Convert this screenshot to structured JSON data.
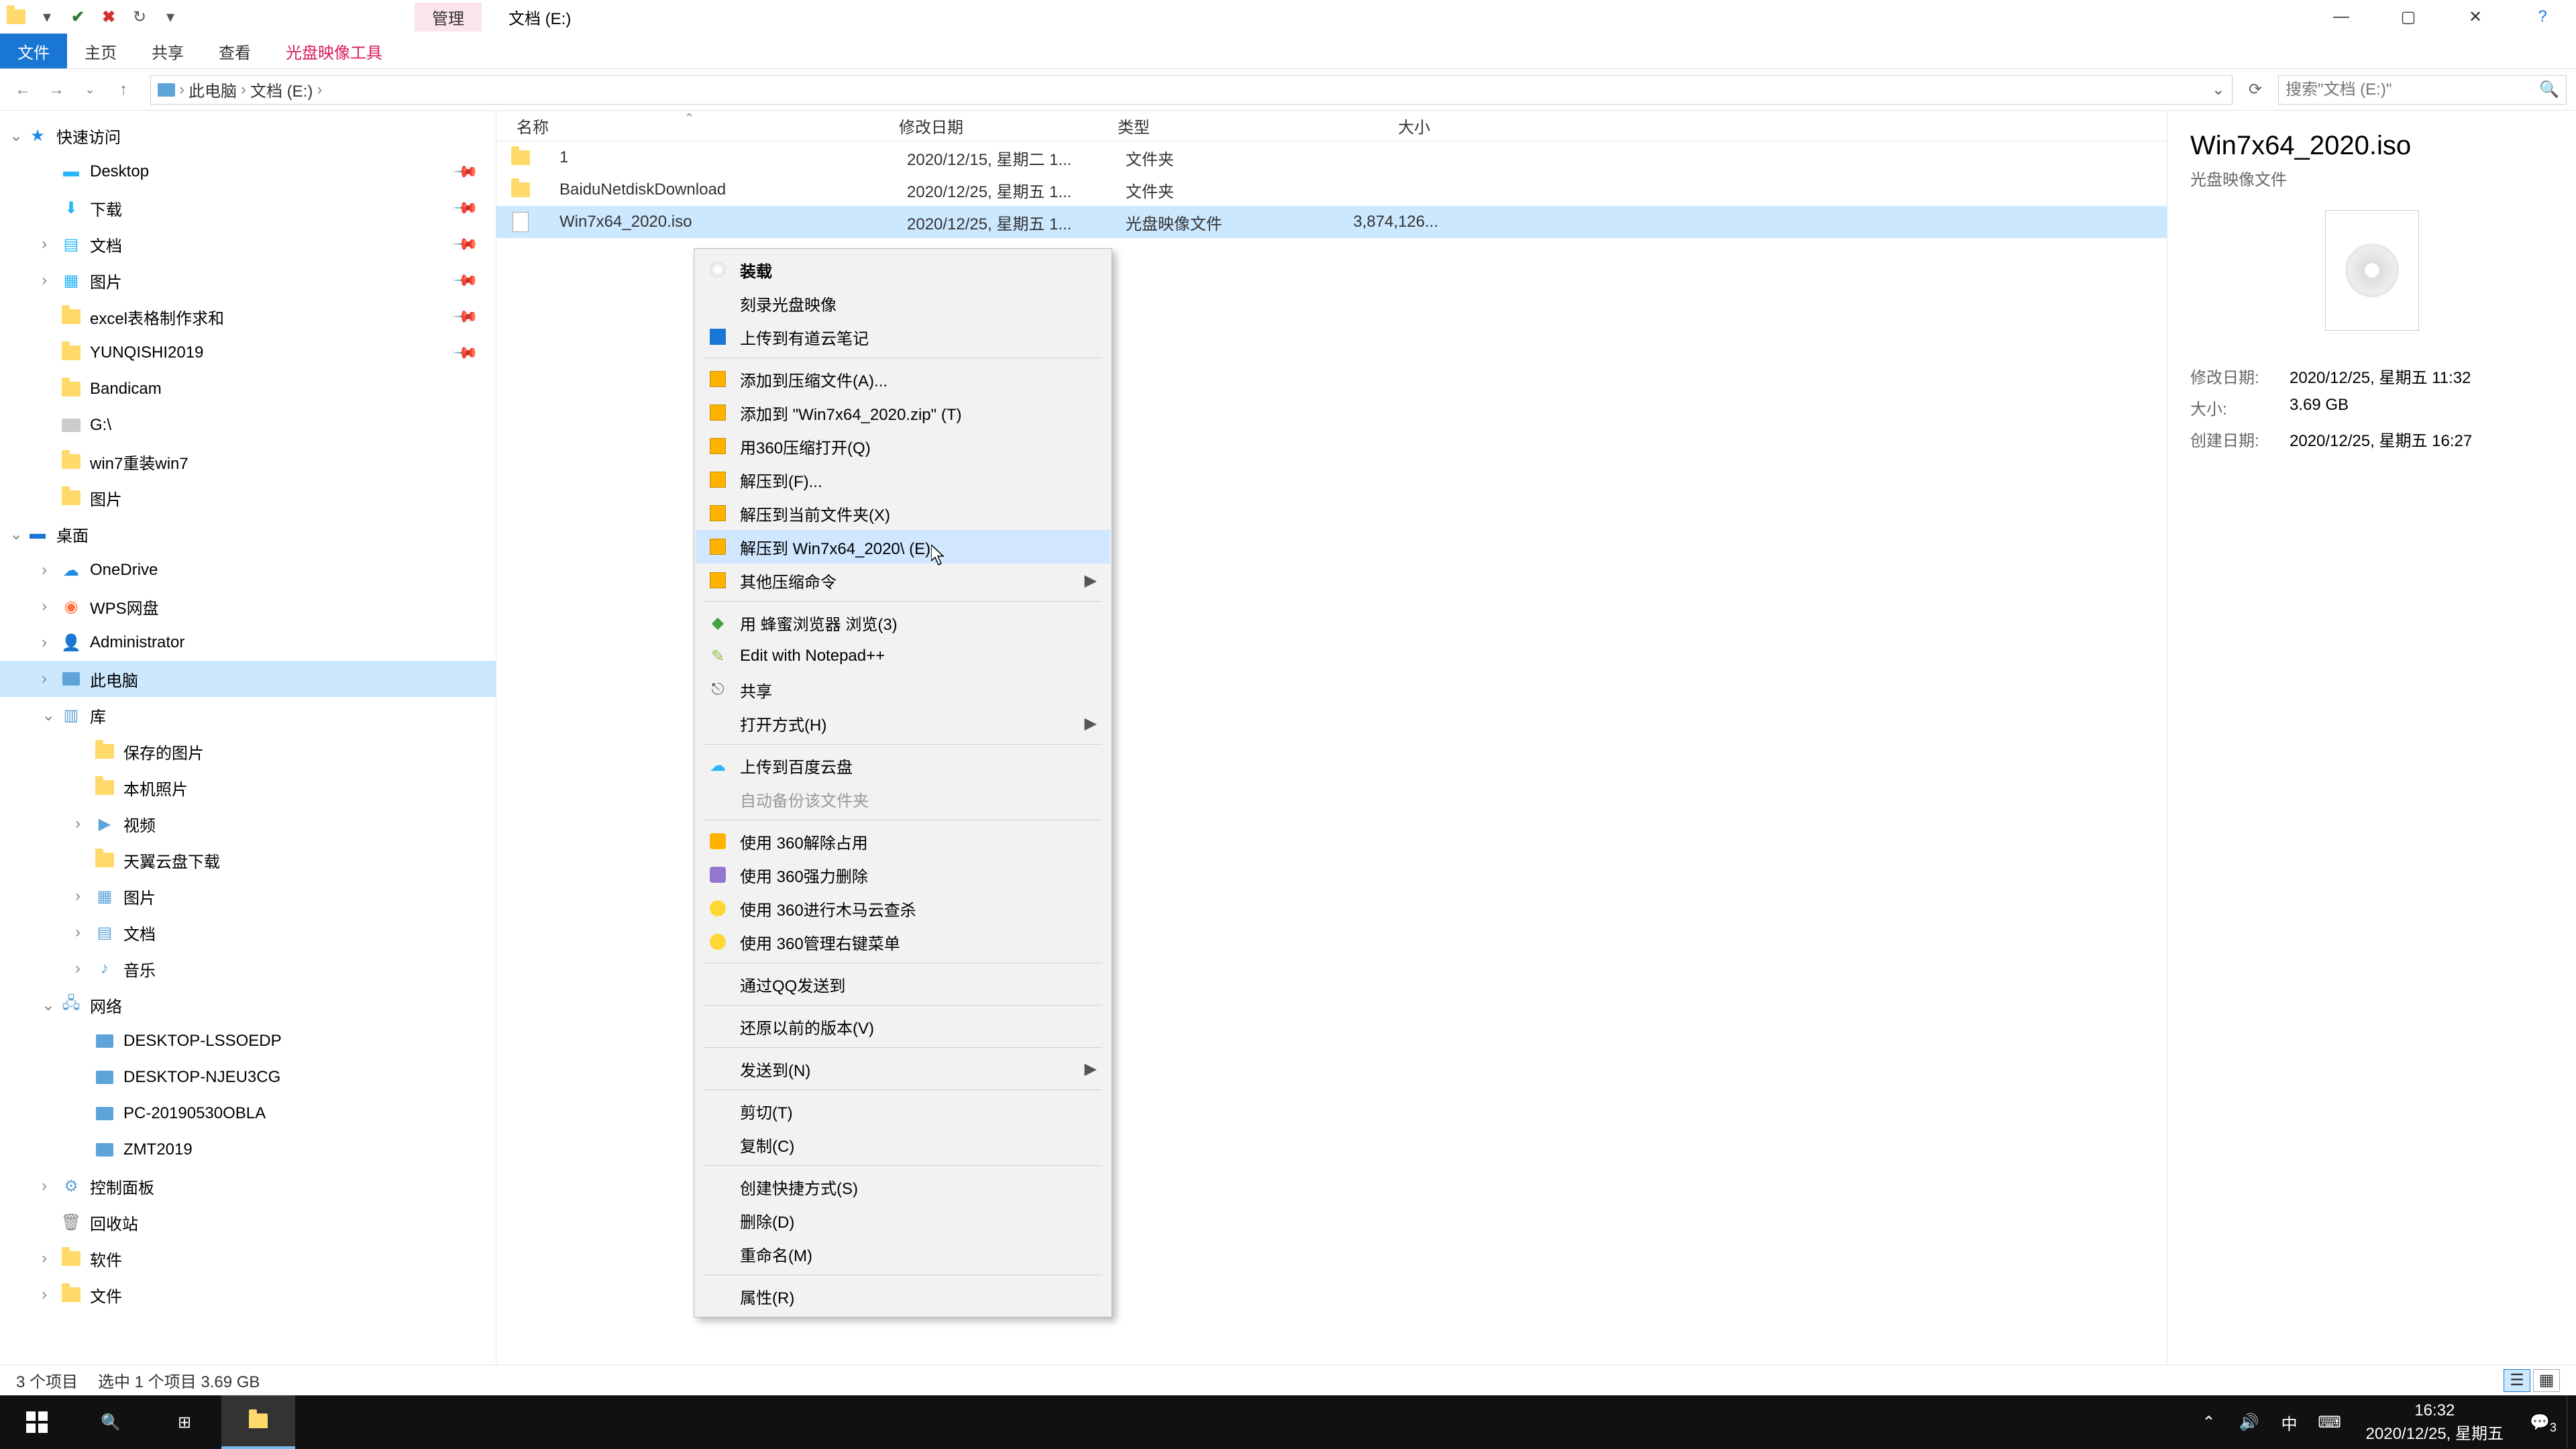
{
  "titlebar": {
    "contextual_tab": "管理",
    "title": "文档 (E:)"
  },
  "ribbon": {
    "file": "文件",
    "home": "主页",
    "share": "共享",
    "view": "查看",
    "disc_tools": "光盘映像工具"
  },
  "address": {
    "root": "此电脑",
    "folder": "文档 (E:)",
    "search_placeholder": "搜索\"文档 (E:)\""
  },
  "tree": {
    "quick": "快速访问",
    "desktop": "Desktop",
    "downloads": "下载",
    "documents": "文档",
    "pictures": "图片",
    "excel": "excel表格制作求和",
    "yunqishi": "YUNQISHI2019",
    "bandicam": "Bandicam",
    "gdrive": "G:\\",
    "win7reset": "win7重装win7",
    "pictures2": "图片",
    "desktop_root": "桌面",
    "onedrive": "OneDrive",
    "wps": "WPS网盘",
    "admin": "Administrator",
    "thispc": "此电脑",
    "libraries": "库",
    "saved_pics": "保存的图片",
    "camera_roll": "本机照片",
    "videos": "视频",
    "tianyi": "天翼云盘下载",
    "lib_pics": "图片",
    "lib_docs": "文档",
    "lib_music": "音乐",
    "network": "网络",
    "pc1": "DESKTOP-LSSOEDP",
    "pc2": "DESKTOP-NJEU3CG",
    "pc3": "PC-20190530OBLA",
    "pc4": "ZMT2019",
    "ctrlpanel": "控制面板",
    "recycle": "回收站",
    "software": "软件",
    "files": "文件"
  },
  "columns": {
    "name": "名称",
    "date": "修改日期",
    "type": "类型",
    "size": "大小"
  },
  "files": [
    {
      "name": "1",
      "date": "2020/12/15, 星期二 1...",
      "type": "文件夹",
      "size": "",
      "icon": "folder"
    },
    {
      "name": "BaiduNetdiskDownload",
      "date": "2020/12/25, 星期五 1...",
      "type": "文件夹",
      "size": "",
      "icon": "folder"
    },
    {
      "name": "Win7x64_2020.iso",
      "date": "2020/12/25, 星期五 1...",
      "type": "光盘映像文件",
      "size": "3,874,126...",
      "icon": "disc",
      "selected": true
    }
  ],
  "context_menu": [
    {
      "label": "装载",
      "bold": true,
      "icon": "disc"
    },
    {
      "label": "刻录光盘映像"
    },
    {
      "label": "上传到有道云笔记",
      "icon": "blue"
    },
    {
      "sep": true
    },
    {
      "label": "添加到压缩文件(A)...",
      "icon": "zip"
    },
    {
      "label": "添加到 \"Win7x64_2020.zip\" (T)",
      "icon": "zip"
    },
    {
      "label": "用360压缩打开(Q)",
      "icon": "zip"
    },
    {
      "label": "解压到(F)...",
      "icon": "zip"
    },
    {
      "label": "解压到当前文件夹(X)",
      "icon": "zip"
    },
    {
      "label": "解压到 Win7x64_2020\\ (E)",
      "icon": "zip",
      "hover": true
    },
    {
      "label": "其他压缩命令",
      "icon": "zip",
      "arrow": true
    },
    {
      "sep": true
    },
    {
      "label": "用 蜂蜜浏览器 浏览(3)",
      "icon": "green"
    },
    {
      "label": "Edit with Notepad++",
      "icon": "npp"
    },
    {
      "label": "共享",
      "icon": "share"
    },
    {
      "label": "打开方式(H)",
      "arrow": true
    },
    {
      "sep": true
    },
    {
      "label": "上传到百度云盘",
      "icon": "cloud"
    },
    {
      "label": "自动备份该文件夹",
      "disabled": true
    },
    {
      "sep": true
    },
    {
      "label": "使用 360解除占用",
      "icon": "360"
    },
    {
      "label": "使用 360强力删除",
      "icon": "360d"
    },
    {
      "label": "使用 360进行木马云查杀",
      "icon": "360s"
    },
    {
      "label": "使用 360管理右键菜单",
      "icon": "360s"
    },
    {
      "sep": true
    },
    {
      "label": "通过QQ发送到"
    },
    {
      "sep": true
    },
    {
      "label": "还原以前的版本(V)"
    },
    {
      "sep": true
    },
    {
      "label": "发送到(N)",
      "arrow": true
    },
    {
      "sep": true
    },
    {
      "label": "剪切(T)"
    },
    {
      "label": "复制(C)"
    },
    {
      "sep": true
    },
    {
      "label": "创建快捷方式(S)"
    },
    {
      "label": "删除(D)"
    },
    {
      "label": "重命名(M)"
    },
    {
      "sep": true
    },
    {
      "label": "属性(R)"
    }
  ],
  "preview": {
    "name": "Win7x64_2020.iso",
    "type": "光盘映像文件",
    "mod_label": "修改日期:",
    "mod": "2020/12/25, 星期五 11:32",
    "size_label": "大小:",
    "size": "3.69 GB",
    "created_label": "创建日期:",
    "created": "2020/12/25, 星期五 16:27"
  },
  "status": {
    "items": "3 个项目",
    "selected": "选中 1 个项目  3.69 GB"
  },
  "taskbar": {
    "ime": "中",
    "time": "16:32",
    "date": "2020/12/25, 星期五",
    "notif_count": "3"
  }
}
